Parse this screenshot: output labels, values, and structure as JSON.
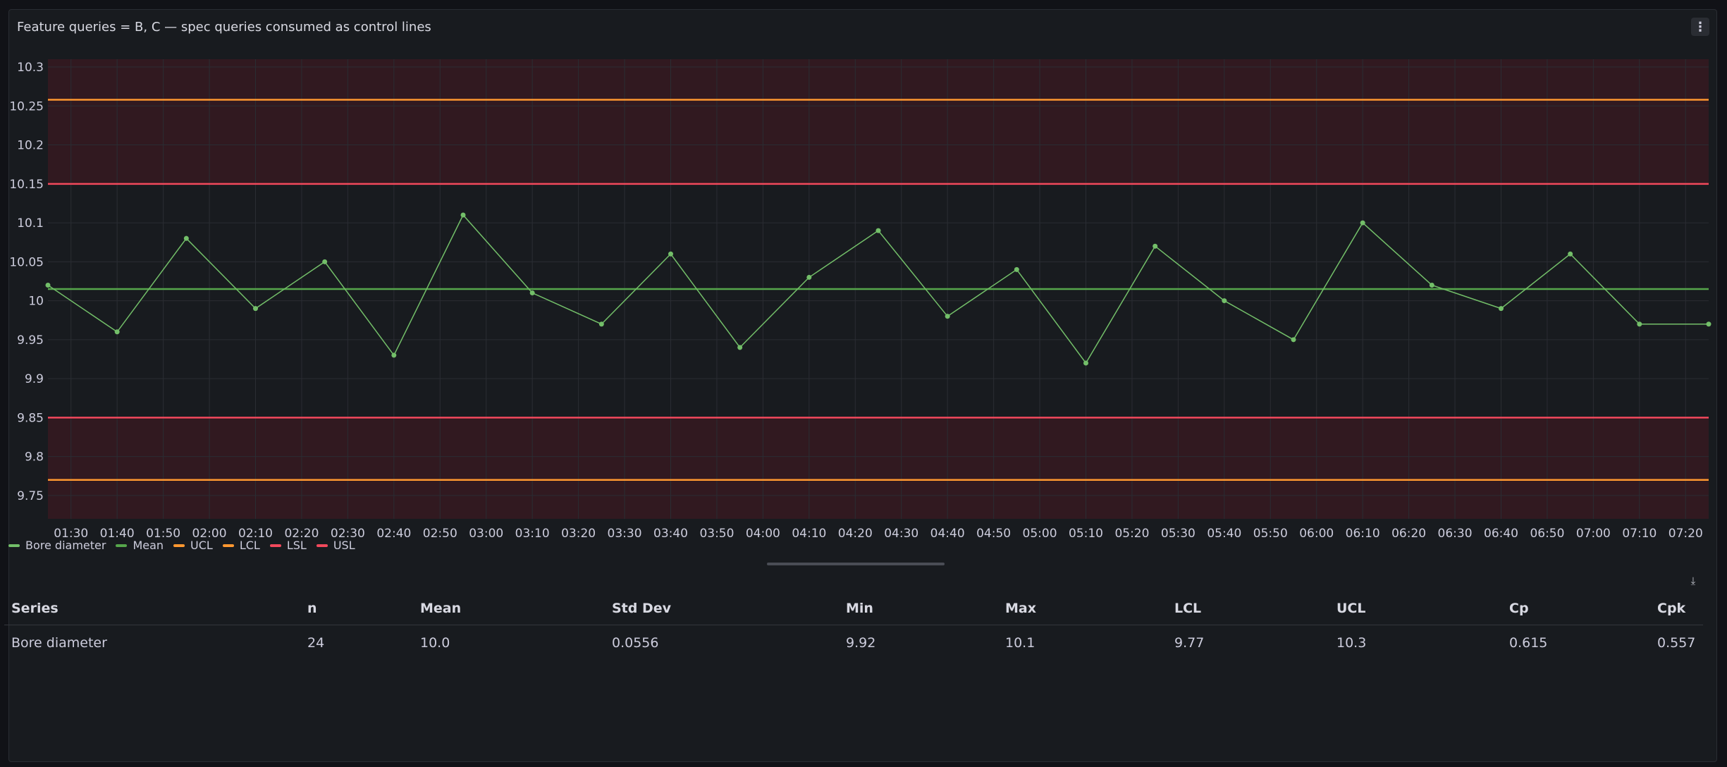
{
  "panel": {
    "title": "Feature queries = B, C — spec queries consumed as control lines",
    "menu_icon": "vertical-ellipsis-icon"
  },
  "colors": {
    "series": "#73bf69",
    "mean": "#56a64b",
    "control": "#ff9830",
    "spec": "#f2495c",
    "band": "#3a1a22",
    "grid": "#2a2d33"
  },
  "chart_data": {
    "type": "line",
    "x_unit": "time",
    "x_ticks": [
      "01:30",
      "01:40",
      "01:50",
      "02:00",
      "02:10",
      "02:20",
      "02:30",
      "02:40",
      "02:50",
      "03:00",
      "03:10",
      "03:20",
      "03:30",
      "03:40",
      "03:50",
      "04:00",
      "04:10",
      "04:20",
      "04:30",
      "04:40",
      "04:50",
      "05:00",
      "05:10",
      "05:20",
      "05:30",
      "05:40",
      "05:50",
      "06:00",
      "06:10",
      "06:20",
      "06:30",
      "06:40",
      "06:50",
      "07:00",
      "07:10",
      "07:20"
    ],
    "y_ticks": [
      10.3,
      10.25,
      10.2,
      10.15,
      10.1,
      10.05,
      10,
      9.95,
      9.9,
      9.85,
      9.8,
      9.75
    ],
    "ylim": [
      9.72,
      10.31
    ],
    "xlim": [
      "01:25",
      "07:25"
    ],
    "series": [
      {
        "name": "Bore diameter",
        "x": [
          "01:25",
          "01:40",
          "01:55",
          "02:10",
          "02:25",
          "02:40",
          "02:55",
          "03:10",
          "03:25",
          "03:40",
          "03:55",
          "04:10",
          "04:25",
          "04:40",
          "04:55",
          "05:10",
          "05:25",
          "05:40",
          "05:55",
          "06:10",
          "06:25",
          "06:40",
          "06:55",
          "07:10",
          "07:25"
        ],
        "values": [
          10.02,
          9.96,
          10.08,
          9.99,
          10.05,
          9.93,
          10.11,
          10.01,
          9.97,
          10.06,
          9.94,
          10.03,
          10.09,
          9.98,
          10.04,
          9.92,
          10.07,
          10.0,
          9.95,
          10.1,
          10.02,
          9.99,
          10.06,
          9.97,
          9.97
        ]
      }
    ],
    "lines": [
      {
        "name": "Mean",
        "value": 10.015
      },
      {
        "name": "UCL",
        "value": 10.258
      },
      {
        "name": "LCL",
        "value": 9.77
      },
      {
        "name": "LSL",
        "value": 9.85
      },
      {
        "name": "USL",
        "value": 10.15
      }
    ],
    "legend": [
      "Bore diameter",
      "Mean",
      "UCL",
      "LCL",
      "LSL",
      "USL"
    ],
    "legend_position": "bottom-left",
    "grid": true
  },
  "table": {
    "headers": [
      "Series",
      "n",
      "Mean",
      "Std Dev",
      "Min",
      "Max",
      "LCL",
      "UCL",
      "Cp",
      "Cpk"
    ],
    "rows": [
      [
        "Bore diameter",
        "24",
        "10.0",
        "0.0556",
        "9.92",
        "10.1",
        "9.77",
        "10.3",
        "0.615",
        "0.557"
      ]
    ],
    "download_icon": "download-icon"
  }
}
